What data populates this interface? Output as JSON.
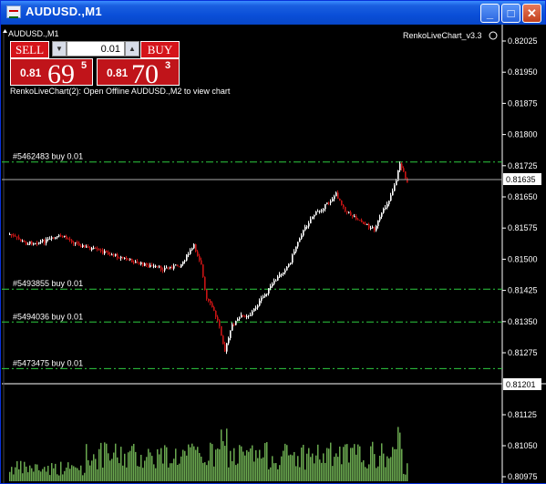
{
  "window": {
    "title": "AUDUSD.,M1",
    "buttons": {
      "minimize": "_",
      "maximize": "□",
      "close": "✕"
    }
  },
  "chart": {
    "symbol_label": "AUDUSD.,M1",
    "indicator_label": "RenkoLiveChart_v3.3",
    "info_text": "RenkoLiveChart(2): Open Offline AUDUSD.,M2 to view chart",
    "price_axis": [
      "0.82025",
      "0.81950",
      "0.81875",
      "0.81800",
      "0.81725",
      "0.81650",
      "0.81575",
      "0.81500",
      "0.81425",
      "0.81350",
      "0.81275"
    ],
    "current_price": "0.81635",
    "volume_axis": [
      "0.81201",
      "0.81125",
      "0.81050",
      "0.80975"
    ],
    "orders": [
      {
        "label": "#5462483 buy 0.01",
        "price": 0.81734
      },
      {
        "label": "#5493855 buy 0.01",
        "price": 0.81428
      },
      {
        "label": "#5494036 buy 0.01",
        "price": 0.81349
      },
      {
        "label": "#5473475 buy 0.01",
        "price": 0.81237
      }
    ],
    "colors": {
      "bull": "#ffffff",
      "bear": "#c81414",
      "order_line": "#2ecc40",
      "volume": "#6aa84f",
      "grid_text": "#ffffff"
    }
  },
  "trade_panel": {
    "sell_label": "SELL",
    "buy_label": "BUY",
    "lot_value": "0.01",
    "bid": {
      "prefix": "0.81",
      "big": "69",
      "sup": "5"
    },
    "ask": {
      "prefix": "0.81",
      "big": "70",
      "sup": "3"
    }
  }
}
